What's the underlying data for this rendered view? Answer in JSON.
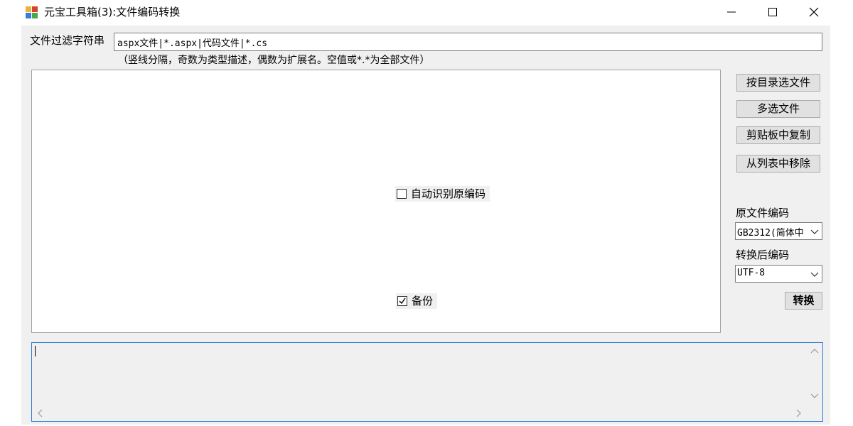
{
  "window": {
    "title": "元宝工具箱(3):文件编码转换",
    "controls": [
      "minimize-icon",
      "maximize-icon",
      "close-icon"
    ]
  },
  "filter": {
    "label": "文件过滤字符串",
    "value": "aspx文件|*.aspx|代码文件|*.cs",
    "hint": "（竖线分隔，奇数为类型描述，偶数为扩展名。空值或*.*为全部文件）"
  },
  "options": {
    "auto_detect_label": "自动识别原编码",
    "auto_detect_checked": false,
    "backup_label": "备份",
    "backup_checked": true
  },
  "buttons": {
    "select_by_dir": "按目录选文件",
    "multi_select": "多选文件",
    "copy_clipboard": "剪贴板中复制",
    "remove_from_list": "从列表中移除",
    "convert": "转换"
  },
  "encoding": {
    "source_label": "原文件编码",
    "source_value": "GB2312(简体中",
    "target_label": "转换后编码",
    "target_value": "UTF-8"
  },
  "log": {
    "text": ""
  },
  "colors": {
    "log_border": "#2a7bd4",
    "client_bg": "#f0f0f0"
  }
}
